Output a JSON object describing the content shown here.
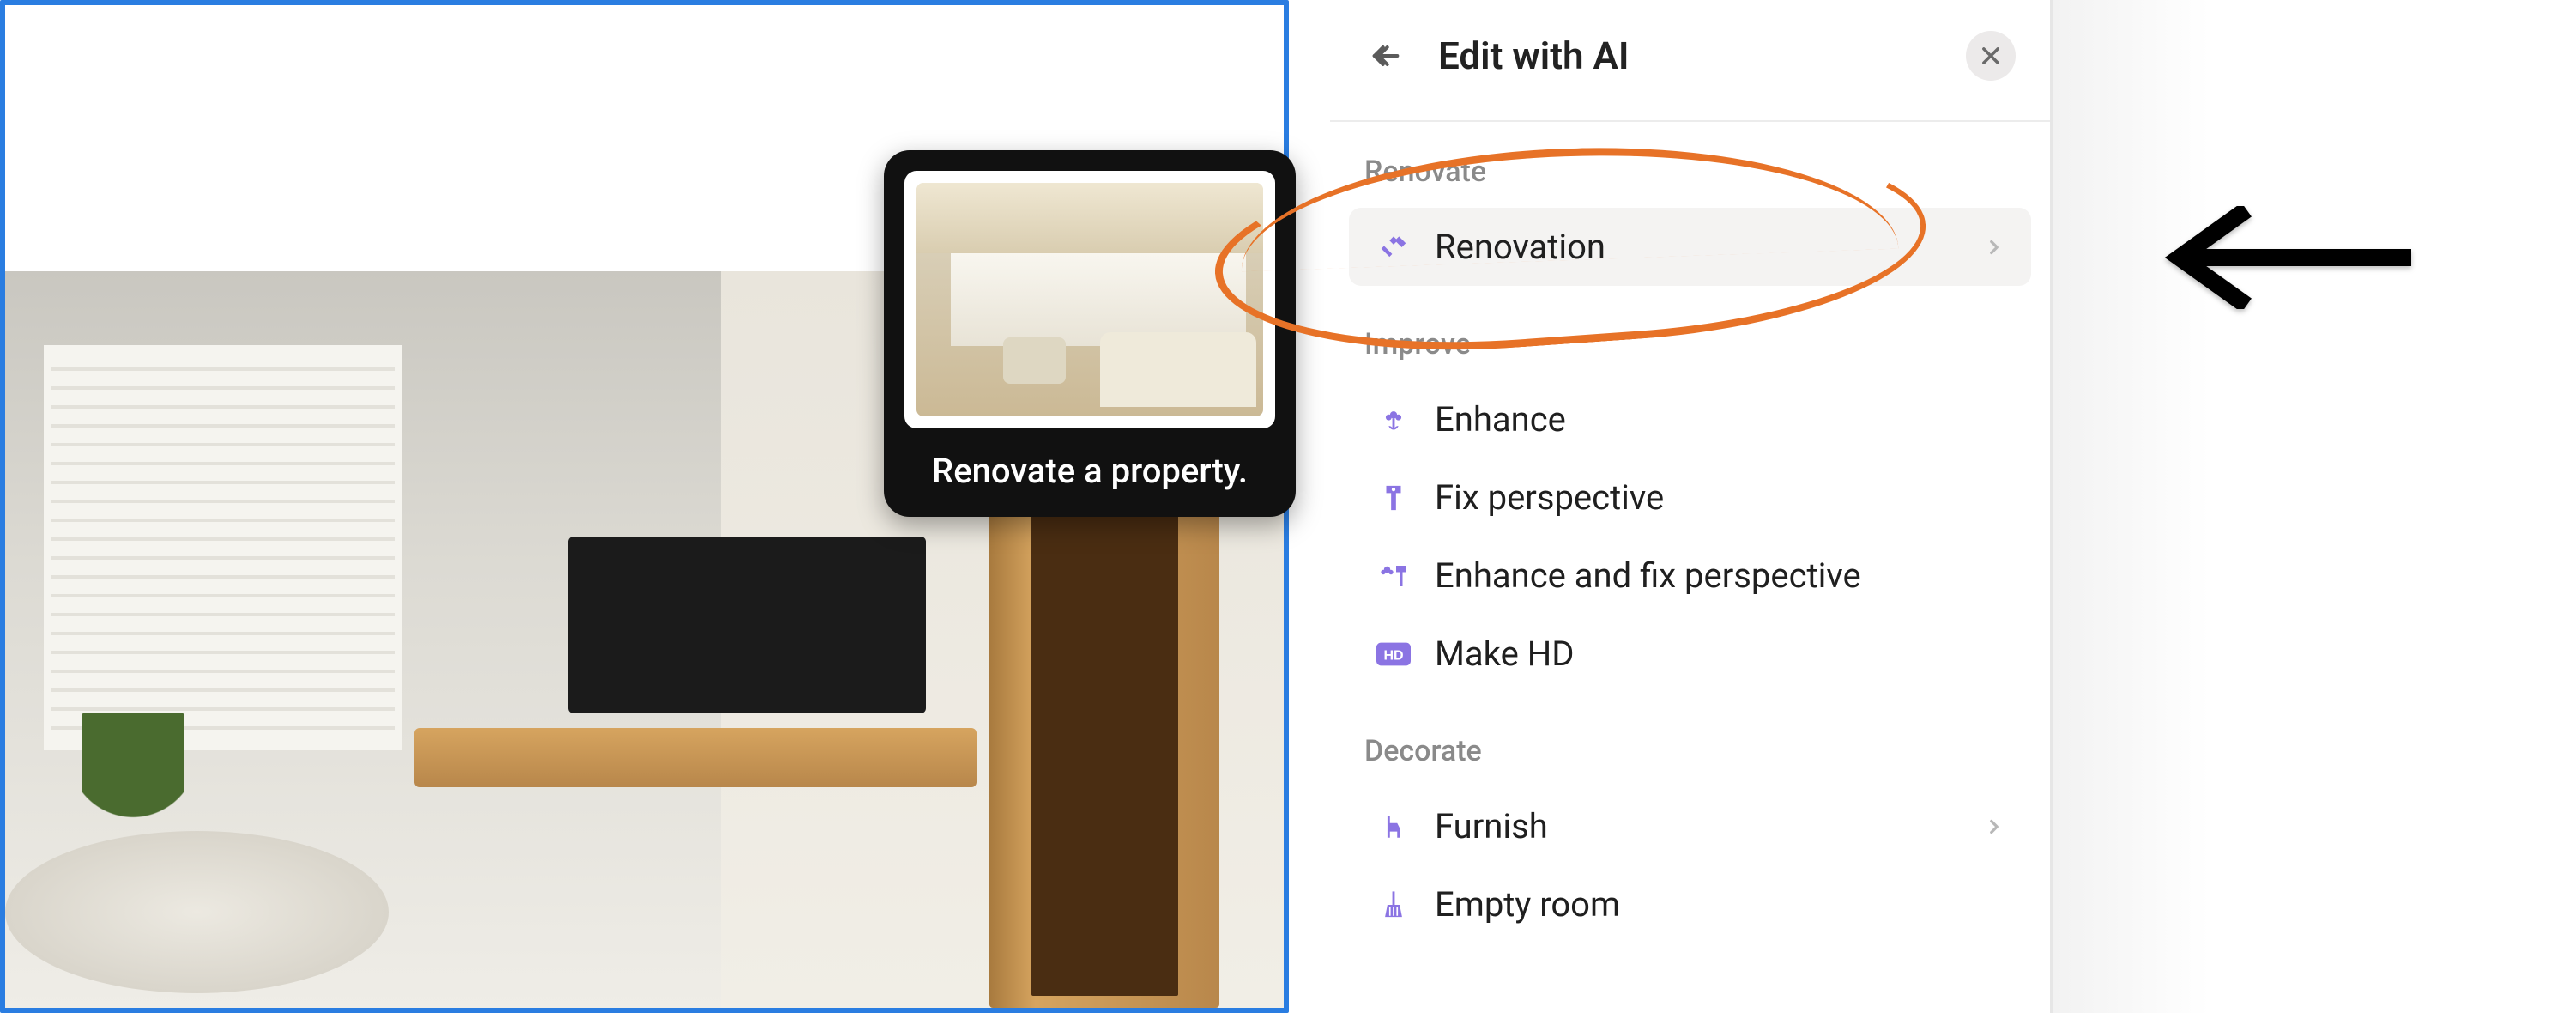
{
  "panel": {
    "title": "Edit with AI",
    "sections": {
      "renovate": {
        "label": "Renovate",
        "items": [
          {
            "label": "Renovation",
            "icon": "hammer-icon",
            "has_chevron": true,
            "hover": true
          }
        ]
      },
      "improve": {
        "label": "Improve",
        "items": [
          {
            "label": "Enhance",
            "icon": "flower-icon"
          },
          {
            "label": "Fix perspective",
            "icon": "perspective-icon"
          },
          {
            "label": "Enhance and fix perspective",
            "icon": "enhance-perspective-icon"
          },
          {
            "label": "Make HD",
            "icon": "hd-icon"
          }
        ]
      },
      "decorate": {
        "label": "Decorate",
        "items": [
          {
            "label": "Furnish",
            "icon": "chair-icon",
            "has_chevron": true
          },
          {
            "label": "Empty room",
            "icon": "broom-icon"
          }
        ]
      }
    }
  },
  "tooltip": {
    "text": "Renovate a property."
  },
  "colors": {
    "accent_purple": "#8b74e3",
    "annotation_orange": "#e77227",
    "selection_blue": "#2a7de1"
  }
}
